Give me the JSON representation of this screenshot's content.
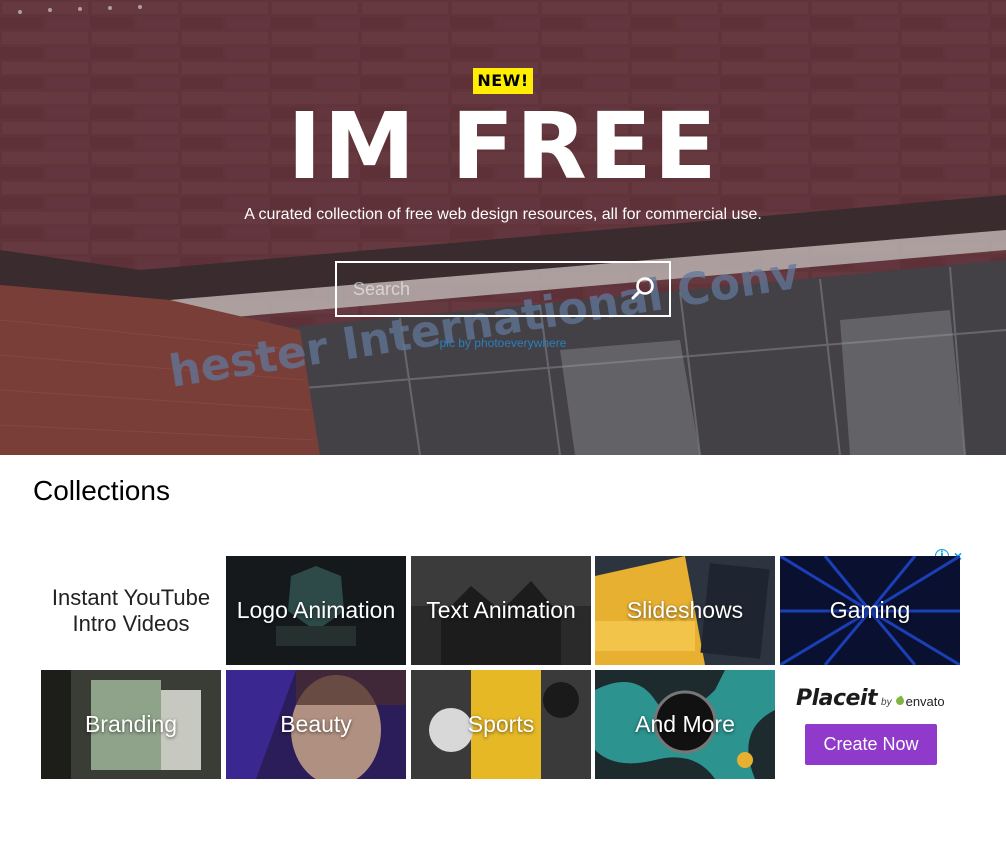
{
  "hero": {
    "badge": "NEW!",
    "title": "IM FREE",
    "subtitle": "A curated collection of free web design resources, all for commercial use.",
    "search_placeholder": "Search",
    "credit": "pic by photoeverywhere",
    "sign_text": "hester International Conv",
    "colors": {
      "badge": "#ffee00",
      "credit_link": "#2a7fbf"
    }
  },
  "collections": {
    "heading": "Collections"
  },
  "ad": {
    "info_icon": "i",
    "close_icon": "×",
    "intro_line1": "Instant YouTube",
    "intro_line2": "Intro Videos",
    "tiles": [
      {
        "label": "Logo Animation"
      },
      {
        "label": "Text Animation"
      },
      {
        "label": "Slideshows"
      },
      {
        "label": "Gaming"
      },
      {
        "label": "Branding"
      },
      {
        "label": "Beauty"
      },
      {
        "label": "Sports"
      },
      {
        "label": "And More"
      }
    ],
    "placeit": {
      "brand": "Placeit",
      "by": "by",
      "partner": "envato",
      "button": "Create Now",
      "button_color": "#8f3acb"
    }
  }
}
